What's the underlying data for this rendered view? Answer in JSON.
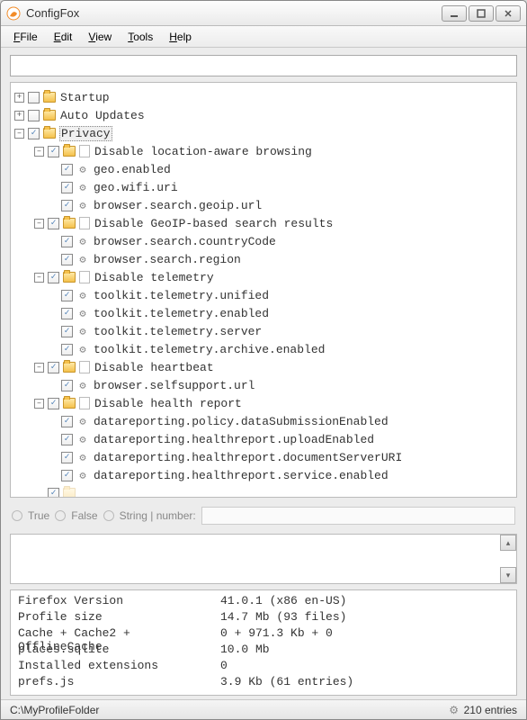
{
  "window_title": "ConfigFox",
  "menu": {
    "file": "File",
    "edit": "Edit",
    "view": "View",
    "tools": "Tools",
    "help": "Help"
  },
  "search": {
    "value": ""
  },
  "tree": {
    "startup": {
      "label": "Startup",
      "expanded": false,
      "checked": false
    },
    "auto_updates": {
      "label": "Auto Updates",
      "expanded": false,
      "checked": false
    },
    "privacy": {
      "label": "Privacy",
      "expanded": true,
      "checked": true,
      "selected": true,
      "groups": [
        {
          "label": "Disable location-aware browsing",
          "checked": true,
          "expanded": true,
          "items": [
            {
              "label": "geo.enabled"
            },
            {
              "label": "geo.wifi.uri"
            },
            {
              "label": "browser.search.geoip.url"
            }
          ]
        },
        {
          "label": "Disable GeoIP-based search results",
          "checked": true,
          "expanded": true,
          "items": [
            {
              "label": "browser.search.countryCode"
            },
            {
              "label": "browser.search.region"
            }
          ]
        },
        {
          "label": "Disable telemetry",
          "checked": true,
          "expanded": true,
          "items": [
            {
              "label": "toolkit.telemetry.unified"
            },
            {
              "label": "toolkit.telemetry.enabled"
            },
            {
              "label": "toolkit.telemetry.server"
            },
            {
              "label": "toolkit.telemetry.archive.enabled"
            }
          ]
        },
        {
          "label": "Disable heartbeat",
          "checked": true,
          "expanded": true,
          "items": [
            {
              "label": "browser.selfsupport.url"
            }
          ]
        },
        {
          "label": "Disable health report",
          "checked": true,
          "expanded": true,
          "items": [
            {
              "label": "datareporting.policy.dataSubmissionEnabled"
            },
            {
              "label": "datareporting.healthreport.uploadEnabled"
            },
            {
              "label": "datareporting.healthreport.documentServerURI"
            },
            {
              "label": "datareporting.healthreport.service.enabled"
            }
          ]
        }
      ]
    }
  },
  "radio": {
    "true_label": "True",
    "false_label": "False",
    "string_label": "String | number:"
  },
  "info": {
    "firefox_version": {
      "label": "Firefox Version",
      "value": "41.0.1 (x86 en-US)"
    },
    "profile_size": {
      "label": "Profile size",
      "value": "14.7 Mb (93 files)"
    },
    "cache": {
      "label": "Cache + Cache2 + OfflineCache",
      "value": "0 + 971.3 Kb + 0"
    },
    "places": {
      "label": "places.sqlite",
      "value": "10.0 Mb"
    },
    "extensions": {
      "label": "Installed extensions",
      "value": "0"
    },
    "prefs": {
      "label": "prefs.js",
      "value": "3.9 Kb (61 entries)"
    }
  },
  "status": {
    "path": "C:\\MyProfileFolder",
    "entries": "210 entries"
  }
}
